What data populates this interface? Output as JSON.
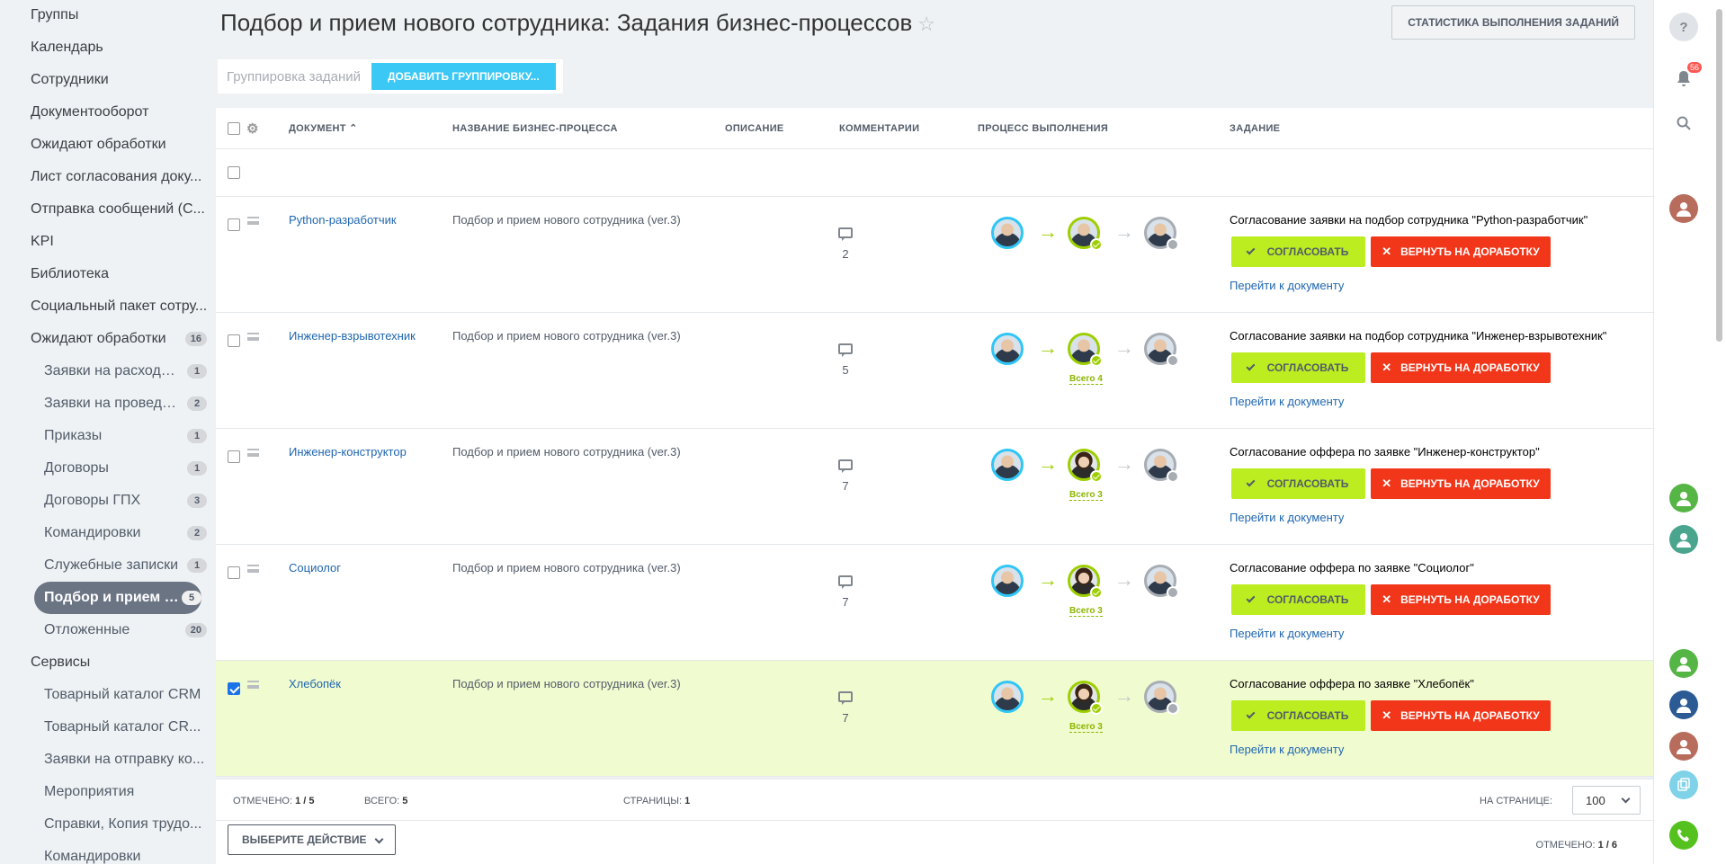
{
  "sidebar": {
    "items": [
      "Группы",
      "Календарь",
      "Сотрудники",
      "Документооборот",
      "Ожидают обработки",
      "Лист согласования доку...",
      "Отправка сообщений (С...",
      "KPI",
      "Библиотека",
      "Социальный пакет сотру..."
    ],
    "waiting": {
      "label": "Ожидают обработки",
      "count": "16"
    },
    "sub": [
      {
        "label": "Заявки на расходо...",
        "count": "1"
      },
      {
        "label": "Заявки на проведе...",
        "count": "2"
      },
      {
        "label": "Приказы",
        "count": "1"
      },
      {
        "label": "Договоры",
        "count": "1"
      },
      {
        "label": "Договоры ГПХ",
        "count": "3"
      },
      {
        "label": "Командировки",
        "count": "2"
      },
      {
        "label": "Служебные записки",
        "count": "1"
      },
      {
        "label": "Подбор и прием н...",
        "count": "5"
      },
      {
        "label": "Отложенные",
        "count": "20"
      }
    ],
    "services": {
      "label": "Сервисы",
      "items": [
        "Товарный каталог CRM",
        "Товарный каталог CR...",
        "Заявки на отправку ко...",
        "Мероприятия",
        "Справки, Копия трудо...",
        "Командировки"
      ]
    }
  },
  "header": {
    "title": "Подбор и прием нового сотрудника: Задания бизнес-процессов",
    "stat_button": "СТАТИСТИКА ВЫПОЛНЕНИЯ ЗАДАНИЙ"
  },
  "grouping": {
    "placeholder": "Группировка заданий",
    "add_button": "ДОБАВИТЬ ГРУППИРОВКУ..."
  },
  "columns": {
    "document": "ДОКУМЕНТ",
    "bp_name": "НАЗВАНИЕ БИЗНЕС-ПРОЦЕССА",
    "description": "ОПИСАНИЕ",
    "comments": "КОММЕНТАРИИ",
    "progress": "ПРОЦЕСС ВЫПОЛНЕНИЯ",
    "task": "ЗАДАНИЕ"
  },
  "rows": [
    {
      "doc": "Python-разработчик",
      "bp": "Подбор и прием нового сотрудника (ver.3)",
      "comments": "2",
      "total": "",
      "task": "Согласование заявки на подбор сотрудника \"Python-разработчик\"",
      "checked": false
    },
    {
      "doc": "Инженер-взрывотехник",
      "bp": "Подбор и прием нового сотрудника (ver.3)",
      "comments": "5",
      "total": "Всего 4",
      "task": "Согласование заявки на подбор сотрудника \"Инженер-взрывотехник\"",
      "checked": false
    },
    {
      "doc": "Инженер-конструктор",
      "bp": "Подбор и прием нового сотрудника (ver.3)",
      "comments": "7",
      "total": "Всего 3",
      "task": "Согласование оффера по заявке \"Инженер-конструктор\"",
      "checked": false
    },
    {
      "doc": "Социолог",
      "bp": "Подбор и прием нового сотрудника (ver.3)",
      "comments": "7",
      "total": "Всего 3",
      "task": "Согласование оффера по заявке \"Социолог\"",
      "checked": false
    },
    {
      "doc": "Хлебопёк",
      "bp": "Подбор и прием нового сотрудника (ver.3)",
      "comments": "7",
      "total": "Всего 3",
      "task": "Согласование оффера по заявке \"Хлебопёк\"",
      "checked": true
    }
  ],
  "buttons": {
    "approve": "СОГЛАСОВАТЬ",
    "return": "ВЕРНУТЬ НА ДОРАБОТКУ",
    "goto": "Перейти к документу"
  },
  "footer": {
    "marked_label": "ОТМЕЧЕНО:",
    "marked": "1 / 5",
    "total_label": "ВСЕГО:",
    "total": "5",
    "pages_label": "СТРАНИЦЫ:",
    "pages": "1",
    "per_page_label": "НА СТРАНИЦЕ:",
    "per_page": "100"
  },
  "actionbar": {
    "select": "ВЫБЕРИТЕ ДЕЙСТВИЕ",
    "marked_label": "ОТМЕЧЕНО:",
    "marked": "1 / 6"
  },
  "rightbar": {
    "notifications": "56"
  },
  "colors": {
    "accent": "#3bc8f5",
    "approve": "#bbed21",
    "return": "#f1361a",
    "selected_row": "#f1fbd0"
  }
}
